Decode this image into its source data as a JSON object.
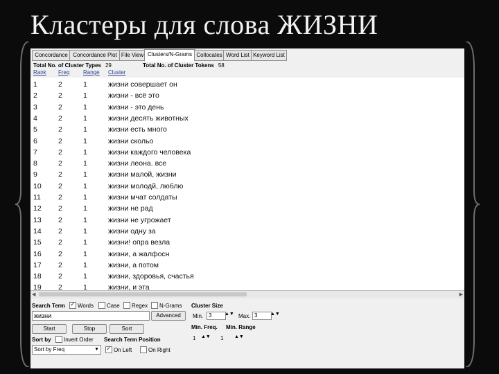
{
  "slide": {
    "title": "Кластеры для слова ЖИЗНИ"
  },
  "tabs": [
    {
      "label": "Concordance"
    },
    {
      "label": "Concordance Plot"
    },
    {
      "label": "File View"
    },
    {
      "label": "Clusters/N-Grams"
    },
    {
      "label": "Collocates"
    },
    {
      "label": "Word List"
    },
    {
      "label": "Keyword List"
    }
  ],
  "summary": {
    "types_label": "Total No. of Cluster Types",
    "types_value": "29",
    "tokens_label": "Total No. of Cluster Tokens",
    "tokens_value": "58"
  },
  "columns": {
    "rank": "Rank",
    "freq": "Freq",
    "range": "Range",
    "cluster": "Cluster"
  },
  "rows": [
    {
      "rank": "1",
      "freq": "2",
      "range": "1",
      "cluster": "жизни совершает он"
    },
    {
      "rank": "2",
      "freq": "2",
      "range": "1",
      "cluster": "жизни - всё это"
    },
    {
      "rank": "3",
      "freq": "2",
      "range": "1",
      "cluster": "жизни - это день"
    },
    {
      "rank": "4",
      "freq": "2",
      "range": "1",
      "cluster": "жизни десять животных"
    },
    {
      "rank": "5",
      "freq": "2",
      "range": "1",
      "cluster": "жизни есть много"
    },
    {
      "rank": "6",
      "freq": "2",
      "range": "1",
      "cluster": "жизни скольо"
    },
    {
      "rank": "7",
      "freq": "2",
      "range": "1",
      "cluster": "жизни каждого человека"
    },
    {
      "rank": "8",
      "freq": "2",
      "range": "1",
      "cluster": "жизни леона. все"
    },
    {
      "rank": "9",
      "freq": "2",
      "range": "1",
      "cluster": "жизни малой, жизни"
    },
    {
      "rank": "10",
      "freq": "2",
      "range": "1",
      "cluster": "жизни молодй, люблю"
    },
    {
      "rank": "11",
      "freq": "2",
      "range": "1",
      "cluster": "жизни мчат солдаты"
    },
    {
      "rank": "12",
      "freq": "2",
      "range": "1",
      "cluster": "жизни не рад"
    },
    {
      "rank": "13",
      "freq": "2",
      "range": "1",
      "cluster": "жизни не угрожает"
    },
    {
      "rank": "14",
      "freq": "2",
      "range": "1",
      "cluster": "жизни одну за"
    },
    {
      "rank": "15",
      "freq": "2",
      "range": "1",
      "cluster": "жизни! опра везла"
    },
    {
      "rank": "16",
      "freq": "2",
      "range": "1",
      "cluster": "жизни, а жалфосн"
    },
    {
      "rank": "17",
      "freq": "2",
      "range": "1",
      "cluster": "жизни, а потом"
    },
    {
      "rank": "18",
      "freq": "2",
      "range": "1",
      "cluster": "жизни, здоровья, счастья"
    },
    {
      "rank": "19",
      "freq": "2",
      "range": "1",
      "cluster": "жизни, и эта"
    }
  ],
  "search": {
    "term_label": "Search Term",
    "words_label": "Words",
    "case_label": "Case",
    "regex_label": "Regex",
    "ngrams_label": "N-Grams",
    "term_value": "жизни",
    "advanced_label": "Advanced",
    "start_label": "Start",
    "stop_label": "Stop",
    "sort_label": "Sort"
  },
  "cluster_size": {
    "label": "Cluster Size",
    "min_label": "Min.",
    "min_value": "3",
    "max_label": "Max.",
    "max_value": "3"
  },
  "min_settings": {
    "freq_label": "Min. Freq.",
    "range_label": "Min. Range",
    "freq_value": "1",
    "range_value": "1"
  },
  "sort": {
    "label": "Sort by",
    "invert_label": "Invert Order",
    "selected": "Sort by Freq"
  },
  "position": {
    "label": "Search Term Position",
    "left_label": "On Left",
    "right_label": "On Right"
  },
  "colors": {
    "accent": "#2a3f8f",
    "background": "#0b0b0b"
  }
}
